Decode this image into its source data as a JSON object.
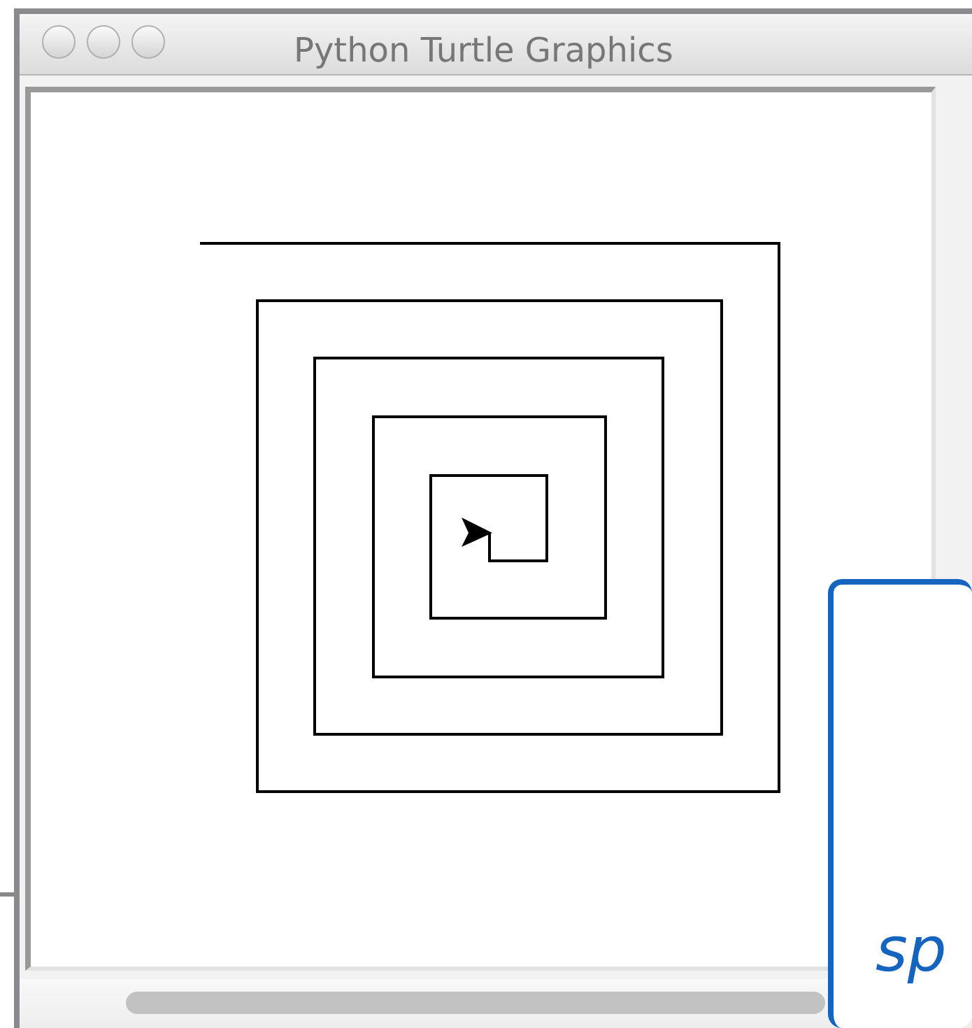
{
  "window": {
    "title": "Python Turtle Graphics"
  },
  "callout": {
    "text": "sp"
  }
}
